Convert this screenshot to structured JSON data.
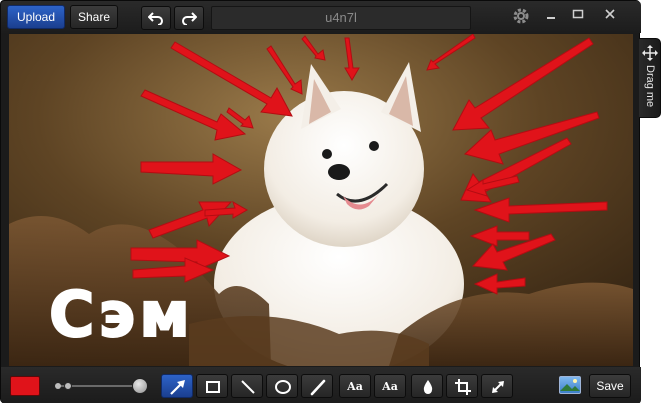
{
  "toolbar": {
    "upload_label": "Upload",
    "share_label": "Share",
    "undo_icon": "undo-icon",
    "redo_icon": "redo-icon",
    "title_value": "u4n7l"
  },
  "window_controls": [
    "settings-icon",
    "minimize-icon",
    "maximize-icon",
    "close-icon"
  ],
  "drag_tab": {
    "label": "Drag me",
    "icon": "move-icon"
  },
  "canvas": {
    "annotation_text": "Сэм",
    "annotation_color": "#e0131a",
    "text_color": "#ffffff"
  },
  "bottom": {
    "color": "#e0131a",
    "size_slider_level": 1.0,
    "tools": [
      {
        "name": "arrow-tool",
        "icon": "arrow-icon",
        "active": true
      },
      {
        "name": "rectangle-tool",
        "icon": "rectangle-icon",
        "active": false
      },
      {
        "name": "line-tool",
        "icon": "line-icon",
        "active": false
      },
      {
        "name": "ellipse-tool",
        "icon": "ellipse-icon",
        "active": false
      },
      {
        "name": "pen-tool",
        "icon": "pen-icon",
        "active": false
      },
      {
        "name": "text-tool",
        "label": "Aa",
        "active": false
      },
      {
        "name": "text-outline-tool",
        "label": "Aa",
        "active": false
      },
      {
        "name": "blur-tool",
        "icon": "drop-icon",
        "active": false
      },
      {
        "name": "crop-tool",
        "icon": "crop-icon",
        "active": false
      },
      {
        "name": "resize-tool",
        "icon": "expand-icon",
        "active": false
      }
    ],
    "image_icon": "image-icon",
    "save_label": "Save"
  }
}
